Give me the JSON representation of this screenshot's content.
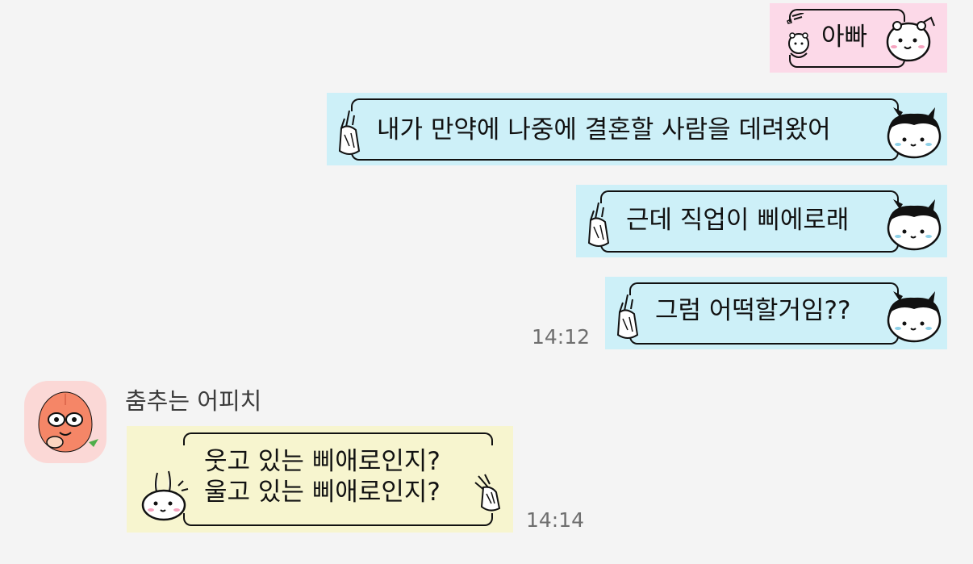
{
  "messages": [
    {
      "id": "m1",
      "text": "아빠",
      "color": "#fcd9e8"
    },
    {
      "id": "m2",
      "text": "내가 만약에 나중에 결혼할 사람을 데려왔어",
      "color": "#cdf0f8"
    },
    {
      "id": "m3",
      "text": "근데 직업이 삐에로래",
      "color": "#cdf0f8"
    },
    {
      "id": "m4",
      "text": "그럼 어떡할거임??",
      "color": "#cdf0f8",
      "time": "14:12"
    }
  ],
  "reply": {
    "sender": "춤추는 어피치",
    "lines": [
      "웃고 있는 삐애로인지?",
      "울고 있는 삐애로인지?"
    ],
    "color": "#f7f5cf",
    "time": "14:14",
    "avatar_icon": "apeach-avatar-icon"
  }
}
